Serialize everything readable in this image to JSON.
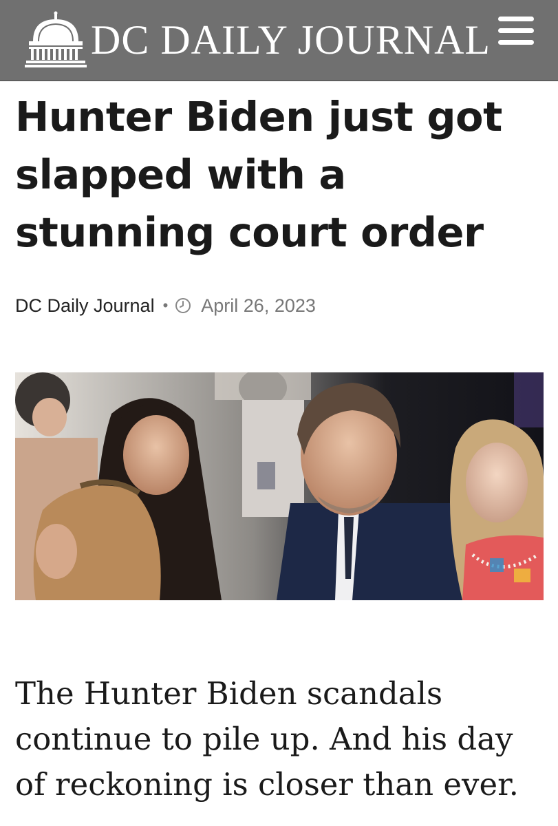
{
  "header": {
    "site_title": "DC DAILY JOURNAL",
    "logo_icon": "capitol-dome-icon",
    "menu_icon": "hamburger-menu-icon",
    "background_color": "#707070"
  },
  "article": {
    "headline": "Hunter Biden just got slapped with a stunning court order",
    "author": "DC Daily Journal",
    "separator": "•",
    "clock_icon": "clock-icon",
    "date": "April 26, 2023",
    "lede": "The Hunter Biden scandals continue to pile up. And his day of reckoning is closer than ever."
  }
}
